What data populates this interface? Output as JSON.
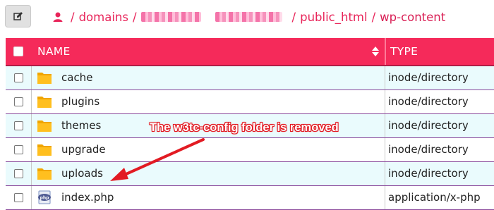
{
  "breadcrumb": {
    "root": "domains",
    "folder1": "public_html",
    "current": "wp-content",
    "separator": "/"
  },
  "table": {
    "headers": {
      "name": "NAME",
      "type": "TYPE"
    },
    "rows": [
      {
        "name": "cache",
        "type": "inode/directory",
        "icon": "folder-icon"
      },
      {
        "name": "plugins",
        "type": "inode/directory",
        "icon": "folder-icon"
      },
      {
        "name": "themes",
        "type": "inode/directory",
        "icon": "folder-icon"
      },
      {
        "name": "upgrade",
        "type": "inode/directory",
        "icon": "folder-icon"
      },
      {
        "name": "uploads",
        "type": "inode/directory",
        "icon": "folder-icon"
      },
      {
        "name": "index.php",
        "type": "application/x-php",
        "icon": "php-file-icon"
      }
    ]
  },
  "annotation": {
    "text": "The w3tc-config folder is removed"
  },
  "colors": {
    "accent": "#f52a5a",
    "row_alt": "#eafbfd",
    "annotation": "#e21b23"
  }
}
